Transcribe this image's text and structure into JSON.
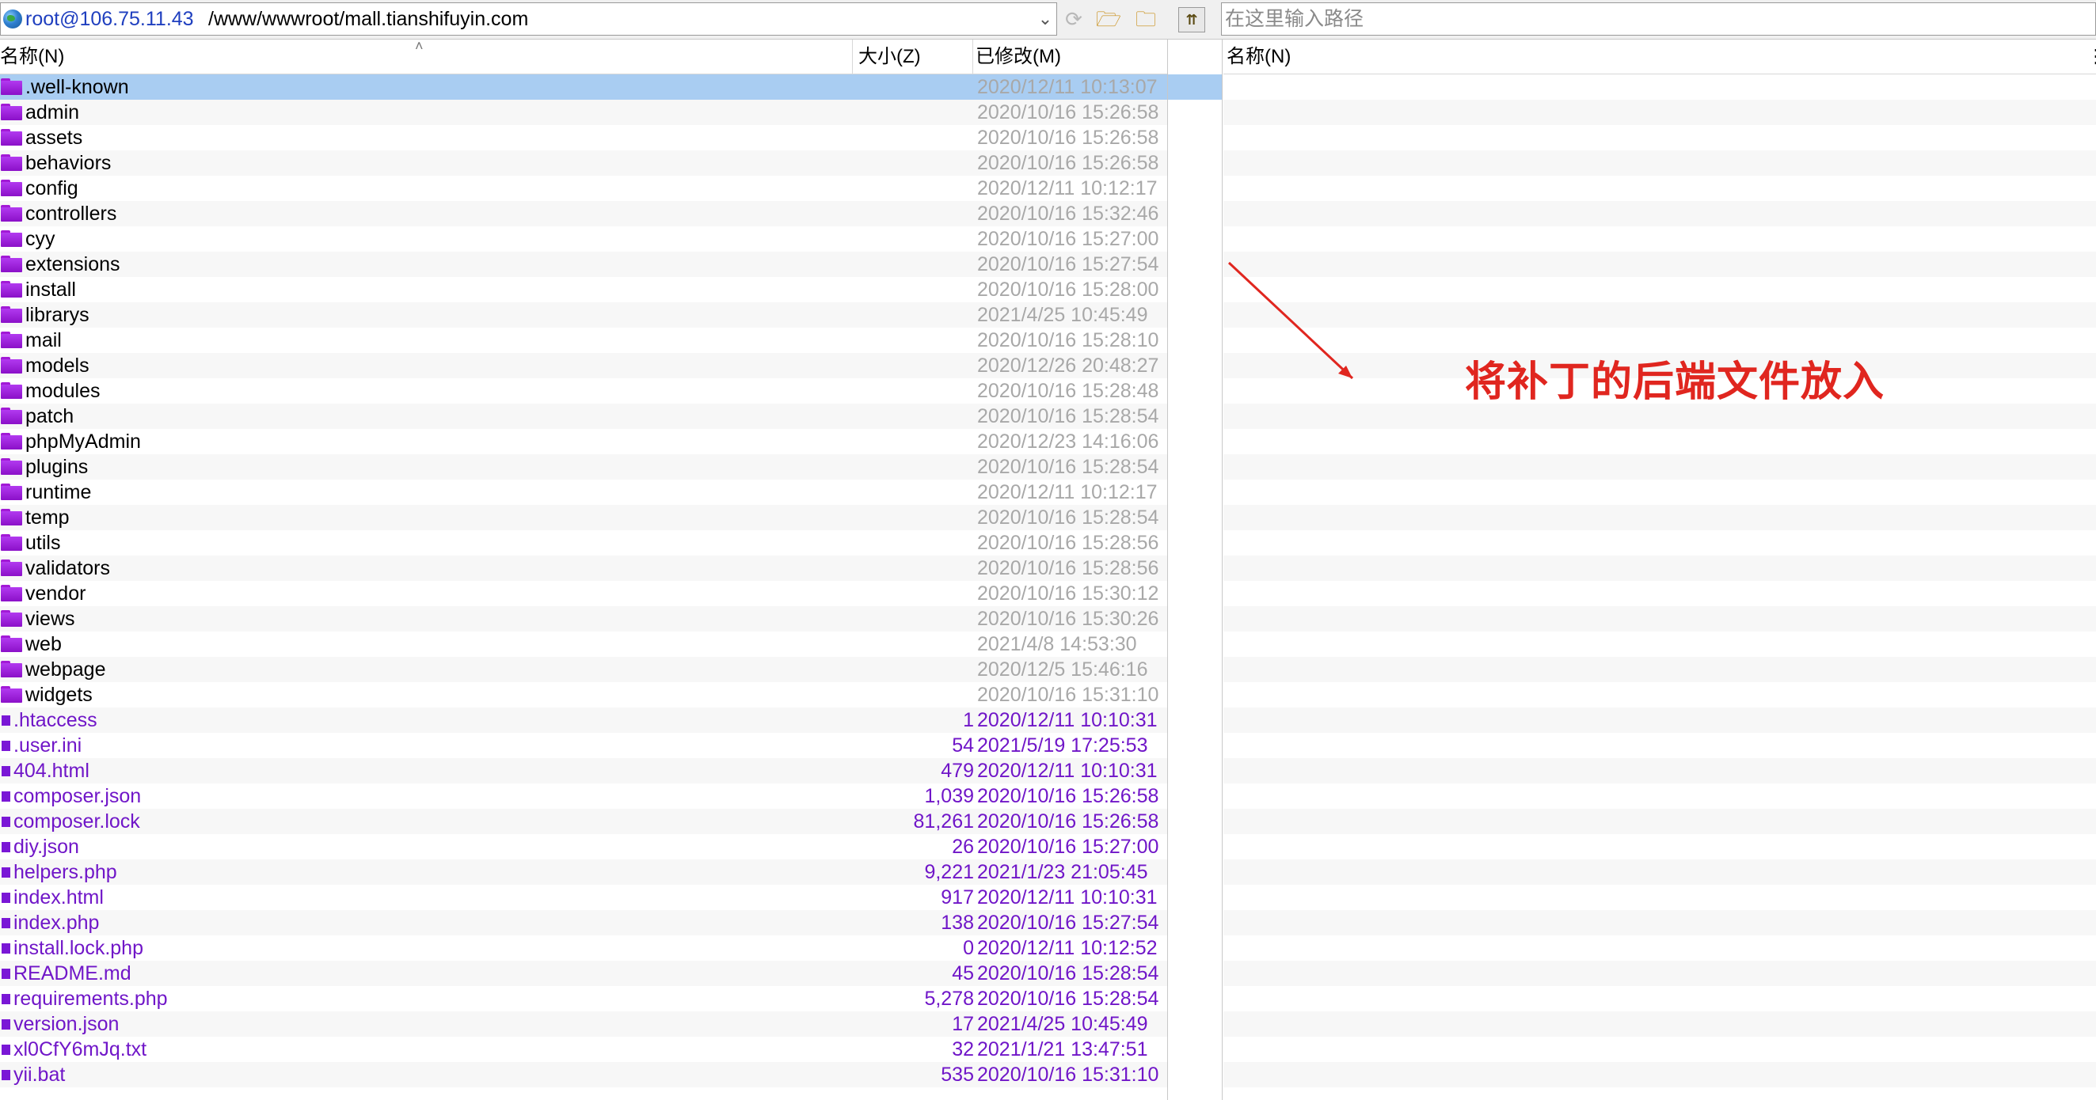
{
  "topbar": {
    "host": "root@106.75.11.43",
    "remote_path": "/www/wwwroot/mall.tianshifuyin.com",
    "local_path_placeholder": "在这里输入路径"
  },
  "left_pane": {
    "columns": {
      "name": "名称(N)",
      "size": "大小(Z)",
      "modified": "已修改(M)"
    },
    "folders": [
      {
        "name": ".well-known",
        "modified": "2020/12/11 10:13:07"
      },
      {
        "name": "admin",
        "modified": "2020/10/16 15:26:58"
      },
      {
        "name": "assets",
        "modified": "2020/10/16 15:26:58"
      },
      {
        "name": "behaviors",
        "modified": "2020/10/16 15:26:58"
      },
      {
        "name": "config",
        "modified": "2020/12/11 10:12:17"
      },
      {
        "name": "controllers",
        "modified": "2020/10/16 15:32:46"
      },
      {
        "name": "cyy",
        "modified": "2020/10/16 15:27:00"
      },
      {
        "name": "extensions",
        "modified": "2020/10/16 15:27:54"
      },
      {
        "name": "install",
        "modified": "2020/10/16 15:28:00"
      },
      {
        "name": "librarys",
        "modified": "2021/4/25 10:45:49"
      },
      {
        "name": "mail",
        "modified": "2020/10/16 15:28:10"
      },
      {
        "name": "models",
        "modified": "2020/12/26 20:48:27"
      },
      {
        "name": "modules",
        "modified": "2020/10/16 15:28:48"
      },
      {
        "name": "patch",
        "modified": "2020/10/16 15:28:54"
      },
      {
        "name": "phpMyAdmin",
        "modified": "2020/12/23 14:16:06"
      },
      {
        "name": "plugins",
        "modified": "2020/10/16 15:28:54"
      },
      {
        "name": "runtime",
        "modified": "2020/12/11 10:12:17"
      },
      {
        "name": "temp",
        "modified": "2020/10/16 15:28:54"
      },
      {
        "name": "utils",
        "modified": "2020/10/16 15:28:56"
      },
      {
        "name": "validators",
        "modified": "2020/10/16 15:28:56"
      },
      {
        "name": "vendor",
        "modified": "2020/10/16 15:30:12"
      },
      {
        "name": "views",
        "modified": "2020/10/16 15:30:26"
      },
      {
        "name": "web",
        "modified": "2021/4/8 14:53:30"
      },
      {
        "name": "webpage",
        "modified": "2020/12/5 15:46:16"
      },
      {
        "name": "widgets",
        "modified": "2020/10/16 15:31:10"
      }
    ],
    "files": [
      {
        "name": ".htaccess",
        "size": "1",
        "modified": "2020/12/11 10:10:31"
      },
      {
        "name": ".user.ini",
        "size": "54",
        "modified": "2021/5/19 17:25:53"
      },
      {
        "name": "404.html",
        "size": "479",
        "modified": "2020/12/11 10:10:31"
      },
      {
        "name": "composer.json",
        "size": "1,039",
        "modified": "2020/10/16 15:26:58"
      },
      {
        "name": "composer.lock",
        "size": "81,261",
        "modified": "2020/10/16 15:26:58"
      },
      {
        "name": "diy.json",
        "size": "26",
        "modified": "2020/10/16 15:27:00"
      },
      {
        "name": "helpers.php",
        "size": "9,221",
        "modified": "2021/1/23 21:05:45"
      },
      {
        "name": "index.html",
        "size": "917",
        "modified": "2020/12/11 10:10:31"
      },
      {
        "name": "index.php",
        "size": "138",
        "modified": "2020/10/16 15:27:54"
      },
      {
        "name": "install.lock.php",
        "size": "0",
        "modified": "2020/12/11 10:12:52"
      },
      {
        "name": "README.md",
        "size": "45",
        "modified": "2020/10/16 15:28:54"
      },
      {
        "name": "requirements.php",
        "size": "5,278",
        "modified": "2020/10/16 15:28:54"
      },
      {
        "name": "version.json",
        "size": "17",
        "modified": "2021/4/25 10:45:49"
      },
      {
        "name": "xl0CfY6mJq.txt",
        "size": "32",
        "modified": "2021/1/21 13:47:51"
      },
      {
        "name": "yii.bat",
        "size": "535",
        "modified": "2020/10/16 15:31:10"
      }
    ]
  },
  "right_pane": {
    "columns": {
      "name": "名称(N)"
    }
  },
  "annotation": {
    "text": "将补丁的后端文件放入",
    "color": "#e0261f"
  },
  "colors": {
    "file_text": "#7016c8",
    "dir_date": "#a8a8a8",
    "selection": "#a9cdf2",
    "host_link": "#1f3fbf"
  },
  "icons": [
    "globe-icon",
    "chevron-down-icon",
    "refresh-icon",
    "open-folder-icon",
    "parent-folder-icon",
    "root-folder-icon",
    "folder-icon",
    "file-icon"
  ]
}
